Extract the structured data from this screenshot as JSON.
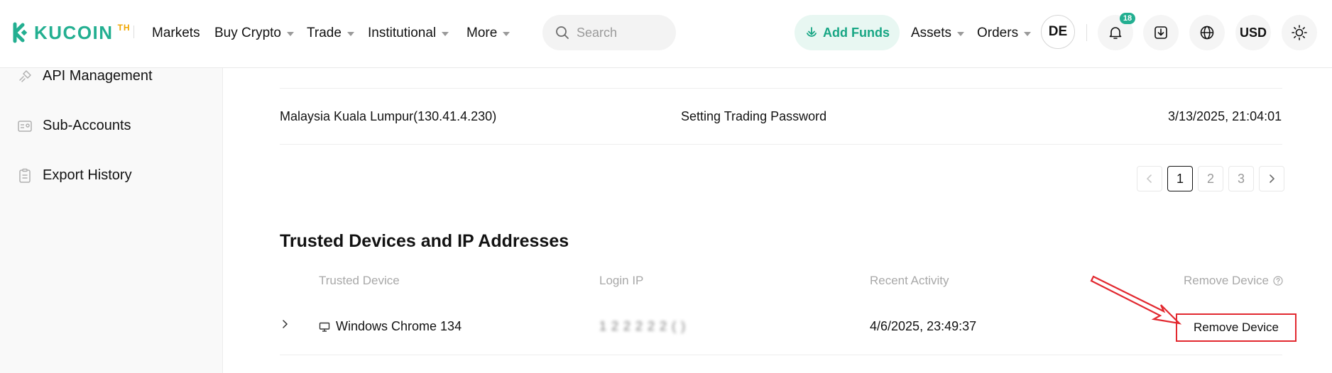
{
  "brand": {
    "name": "KUCOIN",
    "region": "TH",
    "color": "#23af91"
  },
  "nav": {
    "markets": "Markets",
    "buy_crypto": "Buy Crypto",
    "trade": "Trade",
    "institutional": "Institutional",
    "more": "More"
  },
  "search": {
    "placeholder": "Search"
  },
  "header_actions": {
    "add_funds": "Add Funds",
    "assets": "Assets",
    "orders": "Orders",
    "avatar": "DE",
    "notifications_count": "18",
    "currency": "USD"
  },
  "sidebar": {
    "items": [
      {
        "label": "API Management",
        "icon": "api-link-icon"
      },
      {
        "label": "Sub-Accounts",
        "icon": "sub-accounts-icon"
      },
      {
        "label": "Export History",
        "icon": "clipboard-icon"
      }
    ]
  },
  "security_log": {
    "row": {
      "location": "Malaysia Kuala Lumpur(130.41.4.230)",
      "action": "Setting Trading Password",
      "time": "3/13/2025, 21:04:01"
    },
    "pagination": {
      "pages": [
        "1",
        "2",
        "3"
      ],
      "current": "1"
    }
  },
  "trusted_devices": {
    "title": "Trusted Devices and IP Addresses",
    "columns": {
      "device": "Trusted Device",
      "login_ip": "Login IP",
      "recent_activity": "Recent Activity",
      "remove_device": "Remove Device"
    },
    "rows": [
      {
        "device": "Windows Chrome 134",
        "login_ip": "1 2 2 2 2 2 (  )",
        "recent_activity": "4/6/2025, 23:49:37",
        "action": "Remove Device"
      }
    ]
  },
  "annotation": {
    "color": "#e2282f"
  }
}
